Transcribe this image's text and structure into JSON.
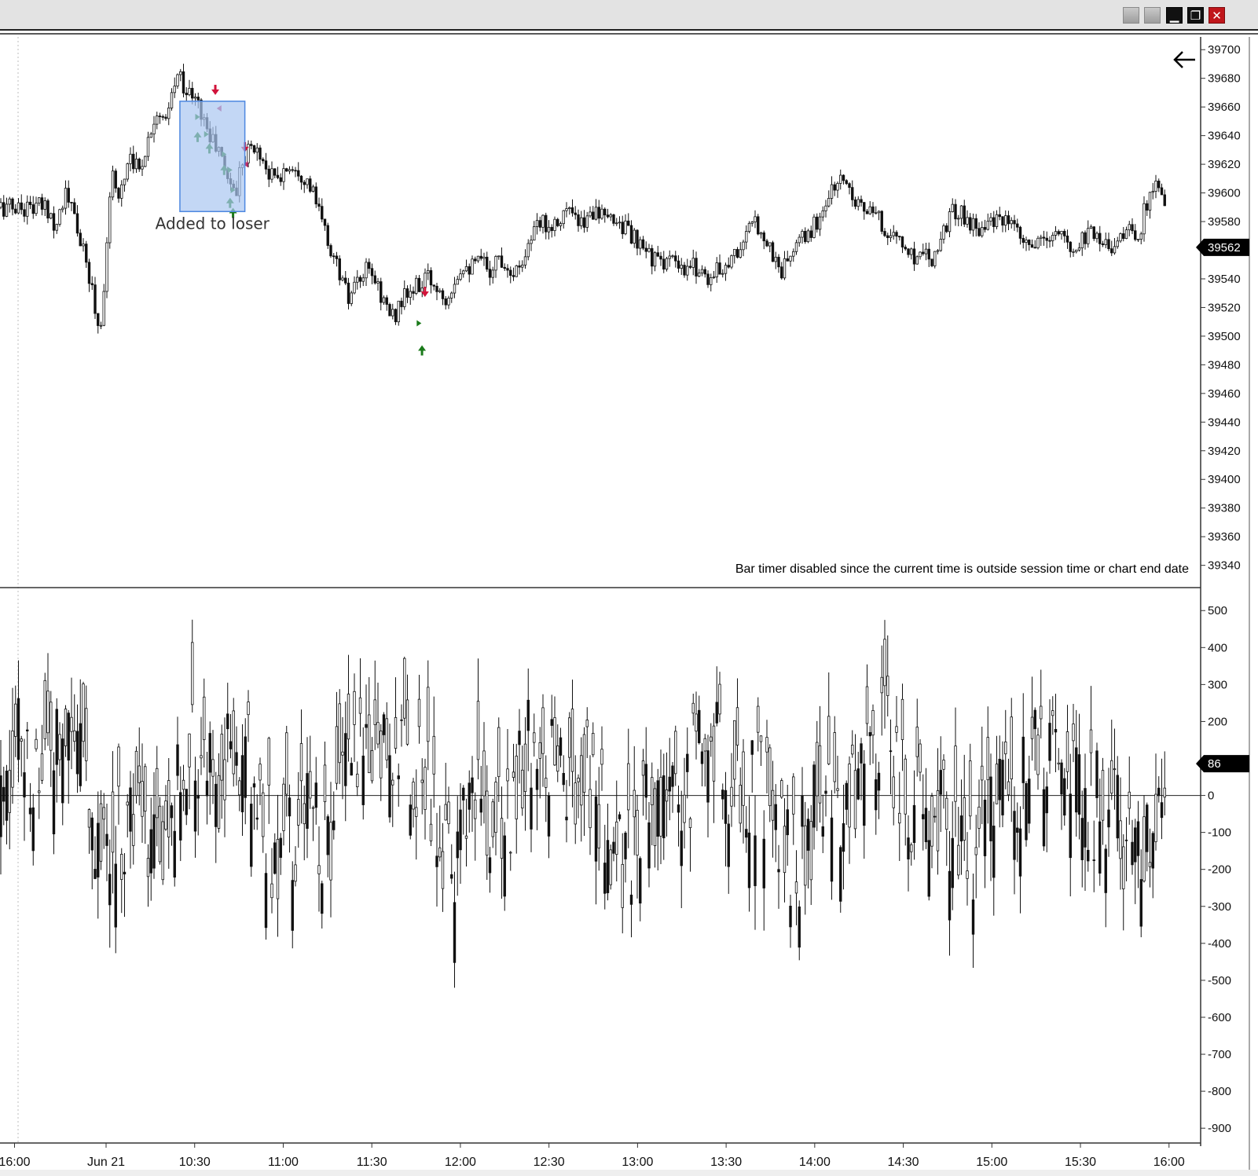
{
  "window": {
    "buttons": [
      {
        "name": "grey-button-1",
        "glyph": ""
      },
      {
        "name": "grey-button-2",
        "glyph": ""
      },
      {
        "name": "minimize-button",
        "glyph": "▁"
      },
      {
        "name": "restore-button",
        "glyph": "❐"
      },
      {
        "name": "close-button",
        "glyph": "✕"
      }
    ]
  },
  "chart_data": [
    {
      "type": "candlestick",
      "ylim": [
        39325,
        39710
      ],
      "yticks": [
        39700,
        39680,
        39660,
        39640,
        39620,
        39600,
        39580,
        39560,
        39540,
        39520,
        39500,
        39480,
        39460,
        39440,
        39420,
        39400,
        39380,
        39360,
        39340
      ],
      "ytick_labels": [
        "39700",
        "39680",
        "39660",
        "39640",
        "39620",
        "39600",
        "39580",
        "",
        "39540",
        "39520",
        "39500",
        "39480",
        "39460",
        "39440",
        "39420",
        "39400",
        "39380",
        "39360",
        "39340"
      ],
      "last_price": 39562,
      "last_price_label": "39562",
      "status_text": "Bar timer disabled since the current time is outside session time or chart end date",
      "annotation": {
        "text": "Added to loser",
        "time_start": "10:25",
        "time_end": "10:47",
        "price_top": 39664,
        "price_bottom": 39587
      },
      "path": [
        [
          "09:40",
          39590
        ],
        [
          "09:43",
          39578
        ],
        [
          "09:46",
          39600
        ],
        [
          "09:49",
          39585
        ],
        [
          "09:52",
          39560
        ],
        [
          "09:55",
          39535
        ],
        [
          "09:58",
          39500
        ],
        [
          "10:00",
          39560
        ],
        [
          "10:02",
          39610
        ],
        [
          "10:05",
          39600
        ],
        [
          "10:08",
          39630
        ],
        [
          "10:11",
          39615
        ],
        [
          "10:14",
          39635
        ],
        [
          "10:17",
          39660
        ],
        [
          "10:20",
          39645
        ],
        [
          "10:23",
          39675
        ],
        [
          "10:25",
          39683
        ],
        [
          "10:27",
          39672
        ],
        [
          "10:30",
          39665
        ],
        [
          "10:32",
          39658
        ],
        [
          "10:35",
          39640
        ],
        [
          "10:38",
          39630
        ],
        [
          "10:41",
          39612
        ],
        [
          "10:44",
          39600
        ],
        [
          "10:46",
          39625
        ],
        [
          "10:49",
          39632
        ],
        [
          "10:52",
          39628
        ],
        [
          "10:55",
          39615
        ],
        [
          "10:58",
          39608
        ],
        [
          "11:01",
          39618
        ],
        [
          "11:04",
          39620
        ],
        [
          "11:07",
          39612
        ],
        [
          "11:10",
          39600
        ],
        [
          "11:13",
          39580
        ],
        [
          "11:16",
          39560
        ],
        [
          "11:19",
          39545
        ],
        [
          "11:22",
          39525
        ],
        [
          "11:25",
          39535
        ],
        [
          "11:28",
          39545
        ],
        [
          "11:31",
          39540
        ],
        [
          "11:34",
          39525
        ],
        [
          "11:37",
          39512
        ],
        [
          "11:40",
          39525
        ],
        [
          "11:43",
          39530
        ],
        [
          "11:46",
          39535
        ],
        [
          "11:49",
          39540
        ],
        [
          "11:52",
          39535
        ],
        [
          "11:55",
          39528
        ],
        [
          "11:58",
          39540
        ],
        [
          "12:01",
          39552
        ],
        [
          "12:04",
          39548
        ],
        [
          "12:07",
          39552
        ],
        [
          "12:10",
          39547
        ],
        [
          "12:13",
          39555
        ],
        [
          "12:16",
          39550
        ],
        [
          "12:19",
          39545
        ],
        [
          "12:22",
          39560
        ],
        [
          "12:25",
          39572
        ],
        [
          "12:28",
          39580
        ],
        [
          "12:31",
          39578
        ],
        [
          "12:34",
          39585
        ],
        [
          "12:37",
          39588
        ],
        [
          "12:40",
          39575
        ],
        [
          "12:43",
          39582
        ],
        [
          "12:46",
          39592
        ],
        [
          "12:49",
          39578
        ],
        [
          "12:52",
          39583
        ],
        [
          "12:55",
          39578
        ],
        [
          "12:58",
          39570
        ],
        [
          "13:01",
          39560
        ],
        [
          "13:04",
          39558
        ],
        [
          "13:07",
          39550
        ],
        [
          "13:10",
          39555
        ],
        [
          "13:13",
          39548
        ],
        [
          "13:16",
          39542
        ],
        [
          "13:19",
          39550
        ],
        [
          "13:22",
          39545
        ],
        [
          "13:25",
          39540
        ],
        [
          "13:28",
          39548
        ],
        [
          "13:31",
          39553
        ],
        [
          "13:34",
          39560
        ],
        [
          "13:37",
          39570
        ],
        [
          "13:40",
          39580
        ],
        [
          "13:43",
          39570
        ],
        [
          "13:46",
          39555
        ],
        [
          "13:49",
          39545
        ],
        [
          "13:52",
          39558
        ],
        [
          "13:55",
          39565
        ],
        [
          "13:58",
          39572
        ],
        [
          "14:01",
          39580
        ],
        [
          "14:04",
          39595
        ],
        [
          "14:07",
          39605
        ],
        [
          "14:10",
          39610
        ],
        [
          "14:13",
          39600
        ],
        [
          "14:16",
          39590
        ],
        [
          "14:19",
          39585
        ],
        [
          "14:22",
          39580
        ],
        [
          "14:25",
          39572
        ],
        [
          "14:28",
          39568
        ],
        [
          "14:31",
          39560
        ],
        [
          "14:34",
          39555
        ],
        [
          "14:37",
          39562
        ],
        [
          "14:40",
          39555
        ],
        [
          "14:43",
          39572
        ],
        [
          "14:46",
          39585
        ],
        [
          "14:49",
          39588
        ],
        [
          "14:52",
          39580
        ],
        [
          "14:55",
          39575
        ],
        [
          "14:58",
          39582
        ],
        [
          "15:01",
          39578
        ],
        [
          "15:04",
          39580
        ],
        [
          "15:07",
          39575
        ],
        [
          "15:10",
          39565
        ],
        [
          "15:13",
          39562
        ],
        [
          "15:16",
          39563
        ],
        [
          "15:19",
          39568
        ],
        [
          "15:22",
          39572
        ],
        [
          "15:25",
          39565
        ],
        [
          "15:28",
          39560
        ],
        [
          "15:31",
          39570
        ],
        [
          "15:34",
          39575
        ],
        [
          "15:37",
          39568
        ],
        [
          "15:40",
          39562
        ],
        [
          "15:43",
          39570
        ],
        [
          "15:46",
          39575
        ],
        [
          "15:49",
          39565
        ],
        [
          "15:52",
          39590
        ],
        [
          "15:55",
          39605
        ],
        [
          "15:57",
          39600
        ],
        [
          "15:59",
          39580
        ],
        [
          "16:00",
          39562
        ]
      ],
      "markers": [
        {
          "type": "sell-arrow",
          "time": "10:37",
          "price": 39670
        },
        {
          "type": "sell-triangle",
          "time": "10:38",
          "price": 39659
        },
        {
          "type": "buy-triangle",
          "time": "10:31",
          "price": 39653
        },
        {
          "type": "buy-triangle",
          "time": "10:34",
          "price": 39641
        },
        {
          "type": "buy-triangle",
          "time": "10:40",
          "price": 39627
        },
        {
          "type": "buy-triangle",
          "time": "10:42",
          "price": 39616
        },
        {
          "type": "buy-triangle",
          "time": "10:43",
          "price": 39602
        },
        {
          "type": "buy-arrow",
          "time": "10:31",
          "price": 39641
        },
        {
          "type": "buy-arrow",
          "time": "10:35",
          "price": 39633
        },
        {
          "type": "buy-arrow",
          "time": "10:40",
          "price": 39618
        },
        {
          "type": "buy-arrow",
          "time": "10:42",
          "price": 39595
        },
        {
          "type": "buy-arrow",
          "time": "10:43",
          "price": 39588
        },
        {
          "type": "sell-arrow",
          "time": "10:47",
          "price": 39630
        },
        {
          "type": "sell-triangle",
          "time": "10:47",
          "price": 39620
        },
        {
          "type": "sell-arrow",
          "time": "11:48",
          "price": 39529
        },
        {
          "type": "buy-triangle",
          "time": "11:46",
          "price": 39509
        },
        {
          "type": "buy-arrow",
          "time": "11:47",
          "price": 39492
        }
      ]
    },
    {
      "type": "bar",
      "ylim": [
        -940,
        560
      ],
      "yticks": [
        500,
        400,
        300,
        200,
        100,
        0,
        -100,
        -200,
        -300,
        -400,
        -500,
        -600,
        -700,
        -800,
        -900
      ],
      "ytick_labels": [
        "500",
        "400",
        "300",
        "200",
        "",
        "0",
        "-100",
        "-200",
        "-300",
        "-400",
        "-500",
        "-600",
        "-700",
        "-800",
        "-900"
      ],
      "last_value": 86,
      "last_value_label": "86",
      "baseline": 0
    }
  ],
  "time_axis": {
    "start": "15:59 prev",
    "ticks": [
      "16:00",
      "Jun 21",
      "10:30",
      "11:00",
      "11:30",
      "12:00",
      "12:30",
      "13:00",
      "13:30",
      "14:00",
      "14:30",
      "15:00",
      "15:30",
      "16:00"
    ],
    "tick_times": [
      "16:00p",
      "10:00",
      "10:30",
      "11:00",
      "11:30",
      "12:00",
      "12:30",
      "13:00",
      "13:30",
      "14:00",
      "14:30",
      "15:00",
      "15:30",
      "16:00"
    ]
  },
  "icons": {
    "back": "arrow-left-icon"
  }
}
